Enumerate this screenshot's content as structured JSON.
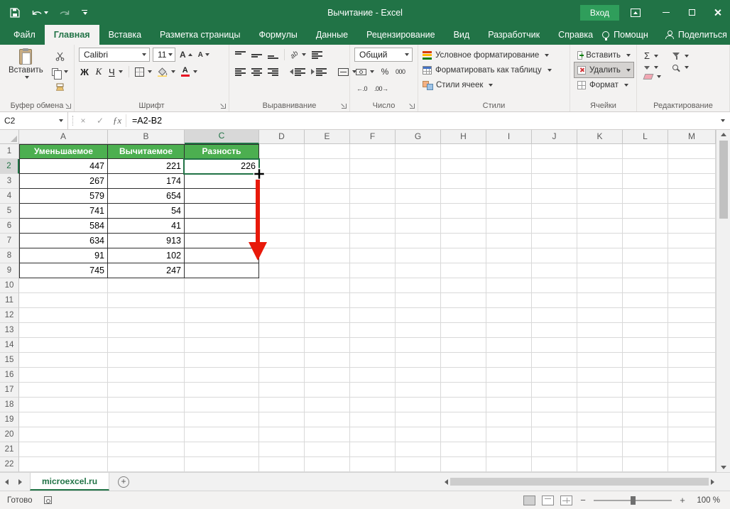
{
  "colors": {
    "accent_green": "#217346",
    "ribbon_bg": "#f3f2f1",
    "table_header_green": "#4caf50",
    "arrow_red": "#e8190a",
    "signin_green": "#2f9e5b",
    "delete_highlight": "#d5d3d1"
  },
  "titlebar": {
    "title": "Вычитание - Excel",
    "signin_label": "Вход"
  },
  "tabs": {
    "items": [
      "Файл",
      "Главная",
      "Вставка",
      "Разметка страницы",
      "Формулы",
      "Данные",
      "Рецензирование",
      "Вид",
      "Разработчик",
      "Справка"
    ],
    "active": "Главная",
    "help_label": "Помощн",
    "share_label": "Поделиться"
  },
  "ribbon": {
    "clipboard": {
      "label": "Буфер обмена",
      "paste_label": "Вставить"
    },
    "font": {
      "label": "Шрифт",
      "font_name": "Calibri",
      "font_size": "11",
      "bold": "Ж",
      "italic": "К",
      "underline": "Ч",
      "grow_letter": "А",
      "shrink_letter": "А",
      "color_letter": "А"
    },
    "alignment": {
      "label": "Выравнивание",
      "orientation_text": "ab"
    },
    "number": {
      "label": "Число",
      "format": "Общий",
      "percent": "%",
      "thousands": "000",
      "inc_decimal": "←.0",
      "dec_decimal": ".00→"
    },
    "styles": {
      "label": "Стили",
      "conditional": "Условное форматирование",
      "format_table": "Форматировать как таблицу",
      "cell_styles": "Стили ячеек"
    },
    "cells": {
      "label": "Ячейки",
      "insert": "Вставить",
      "delete": "Удалить",
      "format": "Формат"
    },
    "editing": {
      "label": "Редактирование",
      "autosum": "Σ"
    }
  },
  "formula_bar": {
    "name_box": "C2",
    "fx": "ƒx",
    "formula": "=A2-B2"
  },
  "grid": {
    "columns": [
      "A",
      "B",
      "C",
      "D",
      "E",
      "F",
      "G",
      "H",
      "I",
      "J",
      "K",
      "L",
      "M"
    ],
    "rows": 22,
    "selected_cell": "C2",
    "selected_column": "C",
    "selected_row": 2,
    "table": {
      "headers": [
        "Уменьшаемое",
        "Вычитаемое",
        "Разность"
      ],
      "data": [
        [
          "447",
          "221",
          "226"
        ],
        [
          "267",
          "174",
          ""
        ],
        [
          "579",
          "654",
          ""
        ],
        [
          "741",
          "54",
          ""
        ],
        [
          "584",
          "41",
          ""
        ],
        [
          "634",
          "913",
          ""
        ],
        [
          "91",
          "102",
          ""
        ],
        [
          "745",
          "247",
          ""
        ]
      ]
    }
  },
  "sheet_bar": {
    "tab": "microexcel.ru"
  },
  "status_bar": {
    "ready": "Готово",
    "zoom": "100 %"
  }
}
